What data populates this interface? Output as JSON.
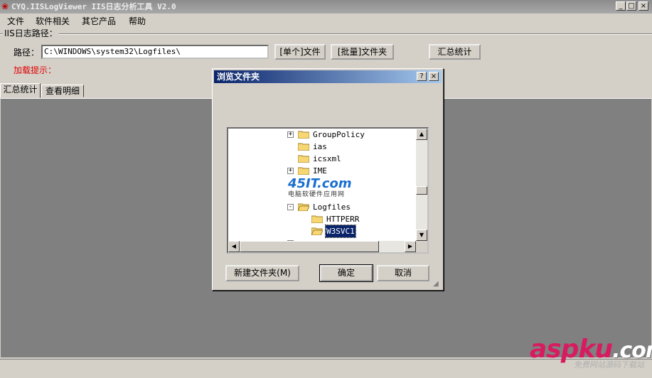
{
  "window": {
    "title": "CYQ.IISLogViewer IIS日志分析工具 V2.0",
    "min_glyph": "_",
    "max_glyph": "□",
    "close_glyph": "×"
  },
  "menu": {
    "items": [
      "文件",
      "软件相关",
      "其它产品",
      "帮助"
    ]
  },
  "form": {
    "group_label": "IIS日志路径：",
    "path_label": "路径：",
    "path_value": "C:\\WINDOWS\\system32\\Logfiles\\",
    "single_file_button": "[单个]文件",
    "batch_folder_button": "[批量]文件夹",
    "summary_button": "汇总统计",
    "load_hint": "加载提示："
  },
  "tabs": [
    {
      "label": "汇总统计",
      "active": true
    },
    {
      "label": "查看明细",
      "active": false
    }
  ],
  "dialog": {
    "title": "浏览文件夹",
    "help_glyph": "?",
    "close_glyph": "×",
    "tree": [
      {
        "label": "GroupPolicy",
        "expander": "+"
      },
      {
        "label": "ias",
        "expander": ""
      },
      {
        "label": "icsxml",
        "expander": ""
      },
      {
        "label": "IME",
        "expander": "+"
      },
      {
        "label": "",
        "expander": ""
      },
      {
        "label": "Logfiles",
        "expander": "-"
      },
      {
        "label": "HTTPERR",
        "expander": ""
      },
      {
        "label": "W3SVC1",
        "expander": "",
        "selected": true
      }
    ],
    "overlay_logo": "45IT.com",
    "overlay_sub": "电脑软硬件应用网",
    "new_folder_button": "新建文件夹(M)",
    "ok_button": "确定",
    "cancel_button": "取消"
  },
  "watermark": {
    "logo_main": "aspku",
    "logo_suffix": ".com",
    "tagline": "免费网站源码下载站"
  },
  "colors": {
    "accent_red": "#e00000",
    "title_active": "#0a246a",
    "panel_gray": "#808080"
  }
}
